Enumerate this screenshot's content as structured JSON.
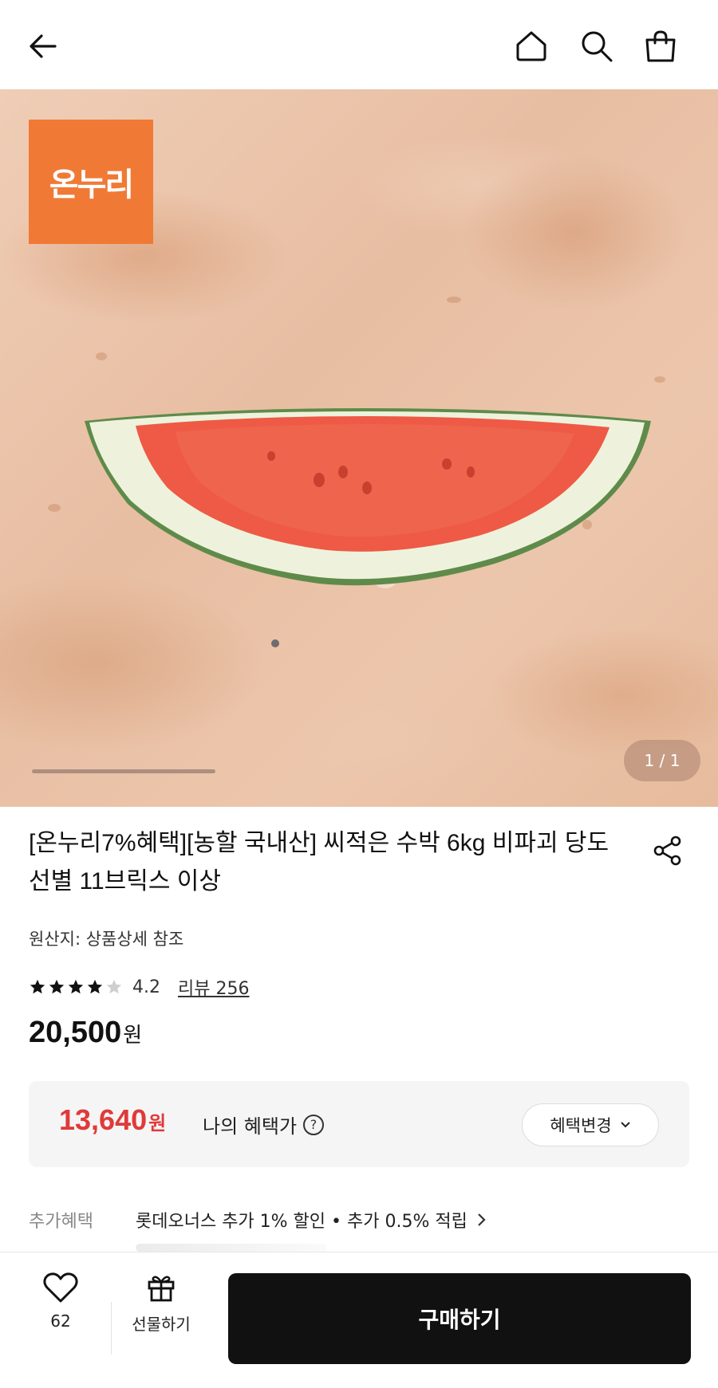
{
  "header": {
    "back_icon": "arrow-left-icon",
    "home_icon": "home-icon",
    "search_icon": "search-icon",
    "cart_icon": "shopping-bag-icon"
  },
  "hero": {
    "brand_logo_text": "온누리",
    "brand_color": "#f07a35",
    "pager": "1 / 1"
  },
  "product": {
    "title": "[온누리7%혜택][농할 국내산] 씨적은 수박 6kg 비파괴 당도선별 11브릭스 이상",
    "origin": "원산지: 상품상세 참조",
    "rating": "4.2",
    "rating_value": 4.2,
    "rating_max": 5,
    "reviews": "리뷰 256",
    "price": "20,500",
    "price_unit": "원"
  },
  "benefit": {
    "price": "13,640",
    "price_unit": "원",
    "label": "나의 혜택가",
    "help": "?",
    "change_button": "혜택변경",
    "accent_color": "#e03a3a"
  },
  "extra": {
    "label": "추가혜택",
    "text": "롯데오너스 추가 1% 할인 • 추가 0.5% 적립"
  },
  "bottom_bar": {
    "like_count": "62",
    "gift_label": "선물하기",
    "buy_label": "구매하기"
  }
}
